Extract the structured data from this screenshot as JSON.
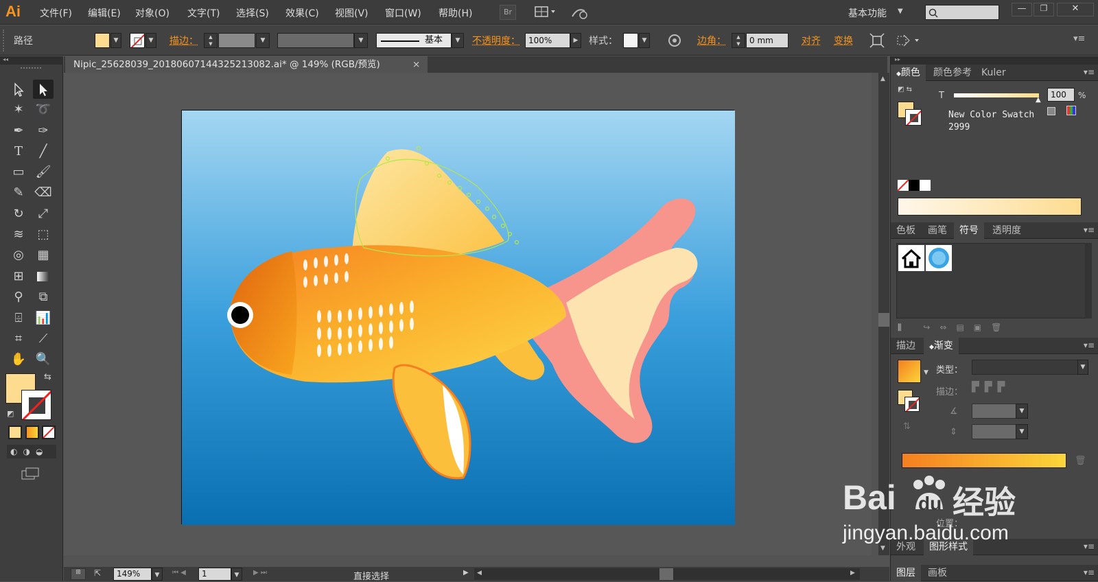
{
  "app": {
    "logo": "Ai",
    "workspace": "基本功能"
  },
  "menu": [
    "文件(F)",
    "编辑(E)",
    "对象(O)",
    "文字(T)",
    "选择(S)",
    "效果(C)",
    "视图(V)",
    "窗口(W)",
    "帮助(H)"
  ],
  "menubar_buttons": {
    "bridge": "Br"
  },
  "control": {
    "selection_type": "路径",
    "stroke_label": "描边：",
    "stroke_style": "基本",
    "opacity_label": "不透明度：",
    "opacity_value": "100%",
    "style_label": "样式：",
    "corner_label": "边角：",
    "corner_value": "0 mm",
    "align_label": "对齐",
    "transform_label": "变换"
  },
  "document": {
    "tab_title": "Nipic_25628039_20180607144325213082.ai* @ 149% (RGB/预览)",
    "close": "×"
  },
  "status": {
    "zoom": "149%",
    "page": "1",
    "tool": "直接选择"
  },
  "panels": {
    "color": {
      "tabs": [
        "颜色",
        "颜色参考",
        "Kuler"
      ],
      "t_label": "T",
      "t_value": "100",
      "percent": "%",
      "swatch_name": "New Color Swatch",
      "swatch_num": "2999"
    },
    "swatches": {
      "tabs": [
        "色板",
        "画笔",
        "符号",
        "透明度"
      ]
    },
    "gradient": {
      "tabs": [
        "描边",
        "渐变"
      ],
      "type_label": "类型：",
      "stroke_label": "描边：",
      "location_label": "位置："
    },
    "appearance": {
      "tabs": [
        "外观",
        "图形样式"
      ]
    },
    "layers": {
      "tabs": [
        "图层",
        "画板"
      ]
    }
  },
  "watermark": {
    "brand": "Bai",
    "brand2": "du",
    "cn": "经验",
    "url": "jingyan.baidu.com"
  },
  "colors": {
    "fill": "#fddc90",
    "accent": "#f7941d",
    "bg_top": "#a4d6f2",
    "bg_bottom": "#0a6fb1"
  }
}
